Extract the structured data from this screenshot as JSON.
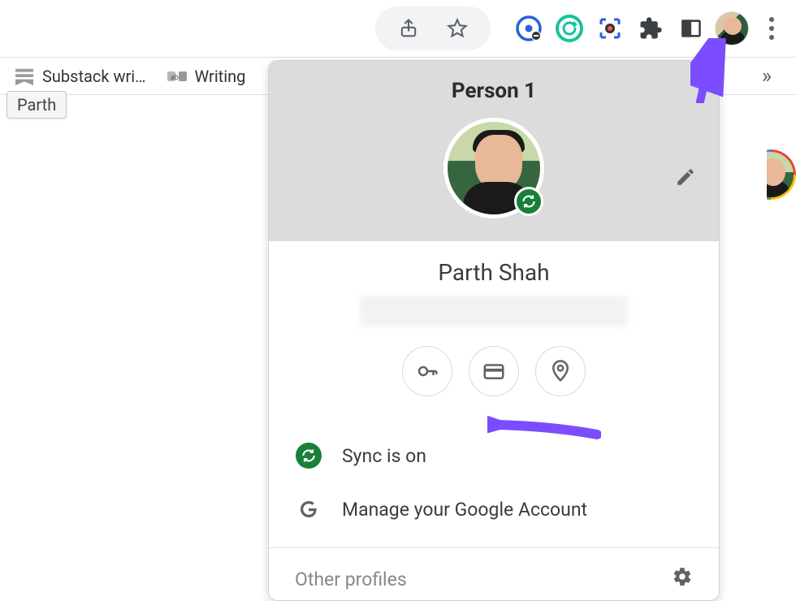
{
  "toolbar": {
    "share_icon": "share-icon",
    "star_icon": "star-icon",
    "extensions": [
      "onetab",
      "grammarly",
      "screenshot",
      "extensions-puzzle",
      "side-panel"
    ]
  },
  "bookmarks": {
    "item1": "Substack wri…",
    "item2": "Writing"
  },
  "tooltip": "Parth",
  "popup": {
    "title": "Person 1",
    "name": "Parth Shah",
    "sync_label": "Sync is on",
    "manage_label": "Manage your Google Account",
    "other_profiles": "Other profiles"
  }
}
